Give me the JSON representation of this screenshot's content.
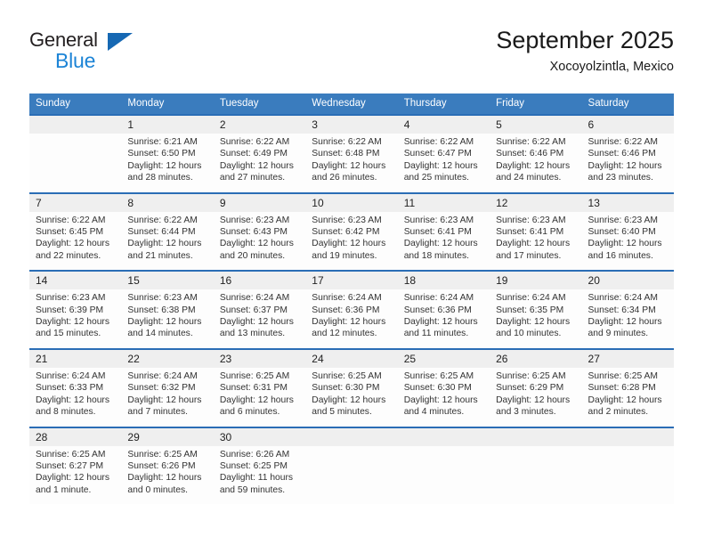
{
  "brand": {
    "word_one": "General",
    "word_two": "Blue",
    "triangle_color": "#1668b3",
    "blue_color": "#1c84d6"
  },
  "header": {
    "title": "September 2025",
    "subtitle": "Xocoyolzintla, Mexico"
  },
  "theme": {
    "header_bg": "#3a7cbe",
    "week_divider": "#2a6db5",
    "daynum_bg": "#efefef",
    "cell_bg": "#fdfdfd"
  },
  "weekday_headers": [
    "Sunday",
    "Monday",
    "Tuesday",
    "Wednesday",
    "Thursday",
    "Friday",
    "Saturday"
  ],
  "weeks": [
    [
      {
        "day": "",
        "sunrise": "",
        "sunset": "",
        "daylight_line1": "",
        "daylight_line2": ""
      },
      {
        "day": "1",
        "sunrise": "Sunrise: 6:21 AM",
        "sunset": "Sunset: 6:50 PM",
        "daylight_line1": "Daylight: 12 hours",
        "daylight_line2": "and 28 minutes."
      },
      {
        "day": "2",
        "sunrise": "Sunrise: 6:22 AM",
        "sunset": "Sunset: 6:49 PM",
        "daylight_line1": "Daylight: 12 hours",
        "daylight_line2": "and 27 minutes."
      },
      {
        "day": "3",
        "sunrise": "Sunrise: 6:22 AM",
        "sunset": "Sunset: 6:48 PM",
        "daylight_line1": "Daylight: 12 hours",
        "daylight_line2": "and 26 minutes."
      },
      {
        "day": "4",
        "sunrise": "Sunrise: 6:22 AM",
        "sunset": "Sunset: 6:47 PM",
        "daylight_line1": "Daylight: 12 hours",
        "daylight_line2": "and 25 minutes."
      },
      {
        "day": "5",
        "sunrise": "Sunrise: 6:22 AM",
        "sunset": "Sunset: 6:46 PM",
        "daylight_line1": "Daylight: 12 hours",
        "daylight_line2": "and 24 minutes."
      },
      {
        "day": "6",
        "sunrise": "Sunrise: 6:22 AM",
        "sunset": "Sunset: 6:46 PM",
        "daylight_line1": "Daylight: 12 hours",
        "daylight_line2": "and 23 minutes."
      }
    ],
    [
      {
        "day": "7",
        "sunrise": "Sunrise: 6:22 AM",
        "sunset": "Sunset: 6:45 PM",
        "daylight_line1": "Daylight: 12 hours",
        "daylight_line2": "and 22 minutes."
      },
      {
        "day": "8",
        "sunrise": "Sunrise: 6:22 AM",
        "sunset": "Sunset: 6:44 PM",
        "daylight_line1": "Daylight: 12 hours",
        "daylight_line2": "and 21 minutes."
      },
      {
        "day": "9",
        "sunrise": "Sunrise: 6:23 AM",
        "sunset": "Sunset: 6:43 PM",
        "daylight_line1": "Daylight: 12 hours",
        "daylight_line2": "and 20 minutes."
      },
      {
        "day": "10",
        "sunrise": "Sunrise: 6:23 AM",
        "sunset": "Sunset: 6:42 PM",
        "daylight_line1": "Daylight: 12 hours",
        "daylight_line2": "and 19 minutes."
      },
      {
        "day": "11",
        "sunrise": "Sunrise: 6:23 AM",
        "sunset": "Sunset: 6:41 PM",
        "daylight_line1": "Daylight: 12 hours",
        "daylight_line2": "and 18 minutes."
      },
      {
        "day": "12",
        "sunrise": "Sunrise: 6:23 AM",
        "sunset": "Sunset: 6:41 PM",
        "daylight_line1": "Daylight: 12 hours",
        "daylight_line2": "and 17 minutes."
      },
      {
        "day": "13",
        "sunrise": "Sunrise: 6:23 AM",
        "sunset": "Sunset: 6:40 PM",
        "daylight_line1": "Daylight: 12 hours",
        "daylight_line2": "and 16 minutes."
      }
    ],
    [
      {
        "day": "14",
        "sunrise": "Sunrise: 6:23 AM",
        "sunset": "Sunset: 6:39 PM",
        "daylight_line1": "Daylight: 12 hours",
        "daylight_line2": "and 15 minutes."
      },
      {
        "day": "15",
        "sunrise": "Sunrise: 6:23 AM",
        "sunset": "Sunset: 6:38 PM",
        "daylight_line1": "Daylight: 12 hours",
        "daylight_line2": "and 14 minutes."
      },
      {
        "day": "16",
        "sunrise": "Sunrise: 6:24 AM",
        "sunset": "Sunset: 6:37 PM",
        "daylight_line1": "Daylight: 12 hours",
        "daylight_line2": "and 13 minutes."
      },
      {
        "day": "17",
        "sunrise": "Sunrise: 6:24 AM",
        "sunset": "Sunset: 6:36 PM",
        "daylight_line1": "Daylight: 12 hours",
        "daylight_line2": "and 12 minutes."
      },
      {
        "day": "18",
        "sunrise": "Sunrise: 6:24 AM",
        "sunset": "Sunset: 6:36 PM",
        "daylight_line1": "Daylight: 12 hours",
        "daylight_line2": "and 11 minutes."
      },
      {
        "day": "19",
        "sunrise": "Sunrise: 6:24 AM",
        "sunset": "Sunset: 6:35 PM",
        "daylight_line1": "Daylight: 12 hours",
        "daylight_line2": "and 10 minutes."
      },
      {
        "day": "20",
        "sunrise": "Sunrise: 6:24 AM",
        "sunset": "Sunset: 6:34 PM",
        "daylight_line1": "Daylight: 12 hours",
        "daylight_line2": "and 9 minutes."
      }
    ],
    [
      {
        "day": "21",
        "sunrise": "Sunrise: 6:24 AM",
        "sunset": "Sunset: 6:33 PM",
        "daylight_line1": "Daylight: 12 hours",
        "daylight_line2": "and 8 minutes."
      },
      {
        "day": "22",
        "sunrise": "Sunrise: 6:24 AM",
        "sunset": "Sunset: 6:32 PM",
        "daylight_line1": "Daylight: 12 hours",
        "daylight_line2": "and 7 minutes."
      },
      {
        "day": "23",
        "sunrise": "Sunrise: 6:25 AM",
        "sunset": "Sunset: 6:31 PM",
        "daylight_line1": "Daylight: 12 hours",
        "daylight_line2": "and 6 minutes."
      },
      {
        "day": "24",
        "sunrise": "Sunrise: 6:25 AM",
        "sunset": "Sunset: 6:30 PM",
        "daylight_line1": "Daylight: 12 hours",
        "daylight_line2": "and 5 minutes."
      },
      {
        "day": "25",
        "sunrise": "Sunrise: 6:25 AM",
        "sunset": "Sunset: 6:30 PM",
        "daylight_line1": "Daylight: 12 hours",
        "daylight_line2": "and 4 minutes."
      },
      {
        "day": "26",
        "sunrise": "Sunrise: 6:25 AM",
        "sunset": "Sunset: 6:29 PM",
        "daylight_line1": "Daylight: 12 hours",
        "daylight_line2": "and 3 minutes."
      },
      {
        "day": "27",
        "sunrise": "Sunrise: 6:25 AM",
        "sunset": "Sunset: 6:28 PM",
        "daylight_line1": "Daylight: 12 hours",
        "daylight_line2": "and 2 minutes."
      }
    ],
    [
      {
        "day": "28",
        "sunrise": "Sunrise: 6:25 AM",
        "sunset": "Sunset: 6:27 PM",
        "daylight_line1": "Daylight: 12 hours",
        "daylight_line2": "and 1 minute."
      },
      {
        "day": "29",
        "sunrise": "Sunrise: 6:25 AM",
        "sunset": "Sunset: 6:26 PM",
        "daylight_line1": "Daylight: 12 hours",
        "daylight_line2": "and 0 minutes."
      },
      {
        "day": "30",
        "sunrise": "Sunrise: 6:26 AM",
        "sunset": "Sunset: 6:25 PM",
        "daylight_line1": "Daylight: 11 hours",
        "daylight_line2": "and 59 minutes."
      },
      {
        "day": "",
        "sunrise": "",
        "sunset": "",
        "daylight_line1": "",
        "daylight_line2": ""
      },
      {
        "day": "",
        "sunrise": "",
        "sunset": "",
        "daylight_line1": "",
        "daylight_line2": ""
      },
      {
        "day": "",
        "sunrise": "",
        "sunset": "",
        "daylight_line1": "",
        "daylight_line2": ""
      },
      {
        "day": "",
        "sunrise": "",
        "sunset": "",
        "daylight_line1": "",
        "daylight_line2": ""
      }
    ]
  ]
}
